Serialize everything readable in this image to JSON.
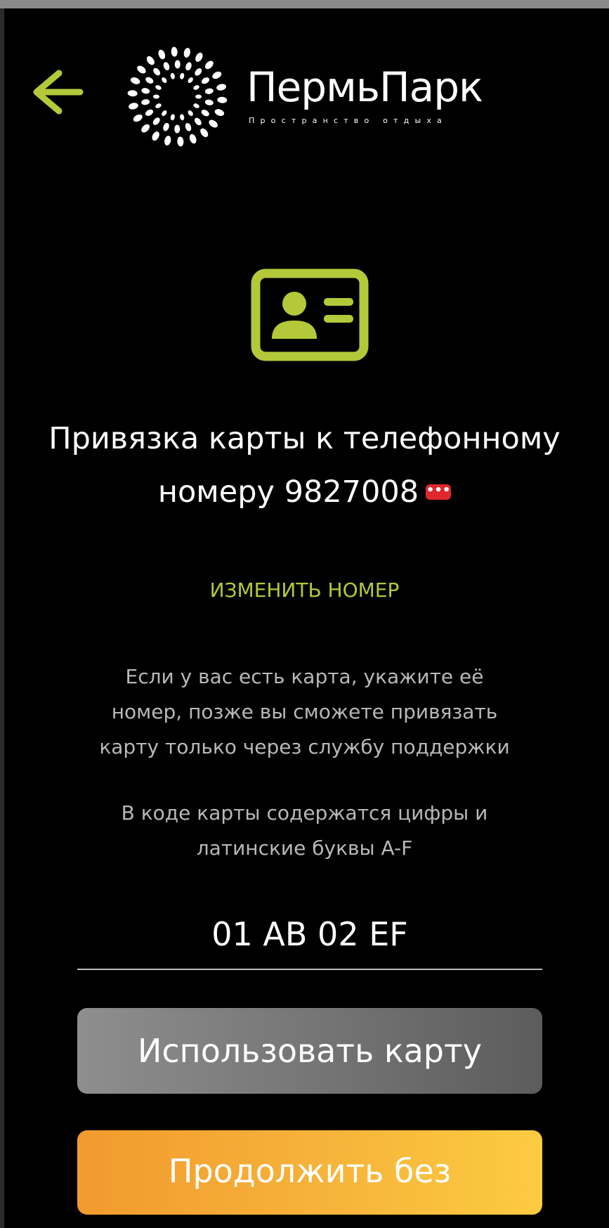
{
  "header": {
    "back_icon": "arrow-left-icon",
    "logo": {
      "name": "ПермьПарк",
      "tagline": "Пространство отдыха"
    }
  },
  "card_icon": "id-card-icon",
  "title": {
    "line1": "Привязка карты к телефонному",
    "line2": "номеру 9827008",
    "masked_indicator": "•••"
  },
  "change_number_label": "ИЗМЕНИТЬ НОМЕР",
  "info": {
    "paragraph1": [
      "Если у вас есть карта, укажите её",
      "номер, позже вы сможете привязать",
      "карту только через службу поддержки"
    ],
    "paragraph2": [
      "В коде карты содержатся цифры и",
      "латинские буквы A-F"
    ]
  },
  "card_code": {
    "placeholder": "01 AB 02 EF",
    "value": ""
  },
  "buttons": {
    "use_card": "Использовать карту",
    "continue_without": "Продолжить без"
  },
  "colors": {
    "background": "#000000",
    "accent": "#b3c93a",
    "secondary_button": "#767676",
    "primary_button": "#f6b43a",
    "mask_badge": "#e0282c"
  }
}
